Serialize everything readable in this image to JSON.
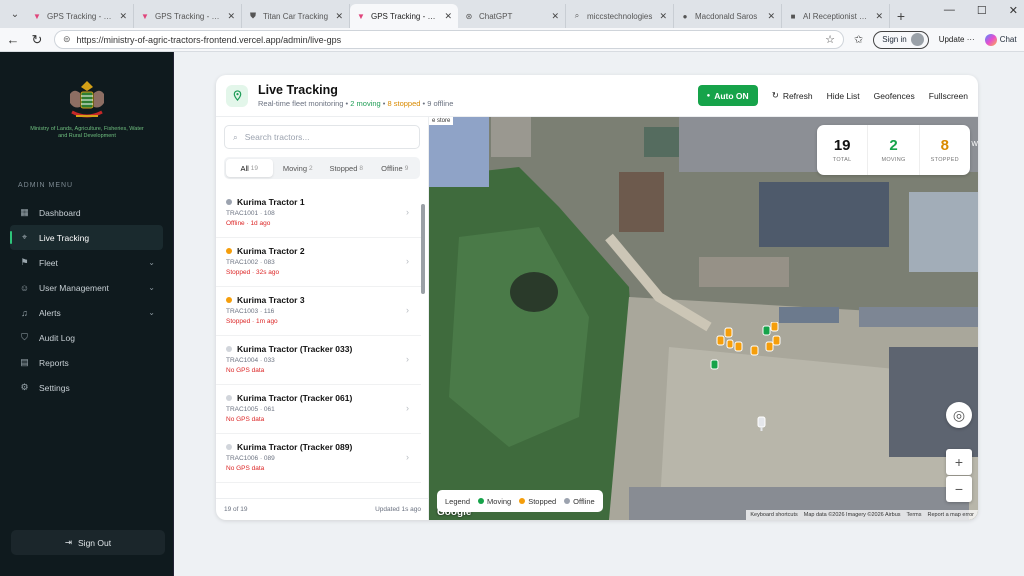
{
  "browser": {
    "tabs": [
      {
        "title": "GPS Tracking - Mini",
        "icon": "v-logo-icon",
        "active": false
      },
      {
        "title": "GPS Tracking - Mini",
        "icon": "v-logo-icon",
        "active": false
      },
      {
        "title": "Titan Car Tracking",
        "icon": "shield-icon",
        "active": false
      },
      {
        "title": "GPS Tracking - Mini",
        "icon": "v-logo-icon",
        "active": true
      },
      {
        "title": "ChatGPT",
        "icon": "chatgpt-icon",
        "active": false
      },
      {
        "title": "miccstechnologies",
        "icon": "search-icon",
        "active": false
      },
      {
        "title": "Macdonald Saros",
        "icon": "user-icon",
        "active": false
      },
      {
        "title": "AI Receptionist Fea",
        "icon": "app-icon",
        "active": false
      }
    ],
    "url": "https://ministry-of-agric-tractors-frontend.vercel.app/admin/live-gps",
    "signin_label": "Sign in",
    "update_label": "Update",
    "chat_label": "Chat"
  },
  "sidebar": {
    "ministry_name": "Ministry of Lands, Agriculture, Fisheries, Water and Rural Development",
    "menu_title": "ADMIN MENU",
    "items": [
      {
        "label": "Dashboard",
        "icon": "grid-icon",
        "chevron": false
      },
      {
        "label": "Live Tracking",
        "icon": "pin-icon",
        "chevron": false,
        "active": true
      },
      {
        "label": "Fleet",
        "icon": "tractor-icon",
        "chevron": true
      },
      {
        "label": "User Management",
        "icon": "users-icon",
        "chevron": true
      },
      {
        "label": "Alerts",
        "icon": "bell-icon",
        "chevron": true
      },
      {
        "label": "Audit Log",
        "icon": "shield-icon",
        "chevron": false
      },
      {
        "label": "Reports",
        "icon": "chart-icon",
        "chevron": false
      },
      {
        "label": "Settings",
        "icon": "gear-icon",
        "chevron": false
      }
    ],
    "signout_label": "Sign Out"
  },
  "header": {
    "title": "Live Tracking",
    "subtitle_prefix": "Real-time fleet monitoring •",
    "moving_text": "2 moving",
    "stopped_text": "8 stopped",
    "offline_text": "9 offline",
    "auto_label": "Auto ON",
    "refresh_label": "Refresh",
    "hide_list_label": "Hide List",
    "geofences_label": "Geofences",
    "fullscreen_label": "Fullscreen"
  },
  "list": {
    "search_placeholder": "Search tractors...",
    "filters": [
      {
        "label": "All",
        "count": "19",
        "active": true
      },
      {
        "label": "Moving",
        "count": "2",
        "active": false
      },
      {
        "label": "Stopped",
        "count": "8",
        "active": false
      },
      {
        "label": "Offline",
        "count": "9",
        "active": false
      }
    ],
    "tractors": [
      {
        "name": "Kurima Tractor 1",
        "id": "TRAC1001 · 108",
        "status": "Offline · 1d ago",
        "dot": "#9ca3af",
        "status_color": "#dc2626"
      },
      {
        "name": "Kurima Tractor 2",
        "id": "TRAC1002 · 083",
        "status": "Stopped · 32s ago",
        "dot": "#f59e0b",
        "status_color": "#dc2626"
      },
      {
        "name": "Kurima Tractor 3",
        "id": "TRAC1003 · 116",
        "status": "Stopped · 1m ago",
        "dot": "#f59e0b",
        "status_color": "#dc2626"
      },
      {
        "name": "Kurima Tractor (Tracker 033)",
        "id": "TRAC1004 · 033",
        "status": "No GPS data",
        "dot": "#d1d5db",
        "status_color": "#dc2626"
      },
      {
        "name": "Kurima Tractor (Tracker 061)",
        "id": "TRAC1005 · 061",
        "status": "No GPS data",
        "dot": "#d1d5db",
        "status_color": "#dc2626"
      },
      {
        "name": "Kurima Tractor (Tracker 089)",
        "id": "TRAC1006 · 089",
        "status": "No GPS data",
        "dot": "#d1d5db",
        "status_color": "#dc2626"
      }
    ],
    "footer_count": "19 of 19",
    "footer_updated": "Updated 1s ago"
  },
  "map": {
    "stats": [
      {
        "value": "19",
        "label": "TOTAL",
        "color": "#111111"
      },
      {
        "value": "2",
        "label": "MOVING",
        "color": "#16a34a"
      },
      {
        "value": "8",
        "label": "STOPPED",
        "color": "#d98a00"
      }
    ],
    "legend_title": "Legend",
    "legend": [
      {
        "label": "Moving",
        "color": "#16a34a"
      },
      {
        "label": "Stopped",
        "color": "#f59e0b"
      },
      {
        "label": "Offline",
        "color": "#9ca3af"
      }
    ],
    "store_label": "e store",
    "google_label": "Google",
    "attribution": [
      "Keyboard shortcuts",
      "Map data ©2026 Imagery ©2026 Airbus",
      "Terms",
      "Report a map error"
    ],
    "zoom_in": "+",
    "zoom_out": "−",
    "side_label": "W"
  }
}
